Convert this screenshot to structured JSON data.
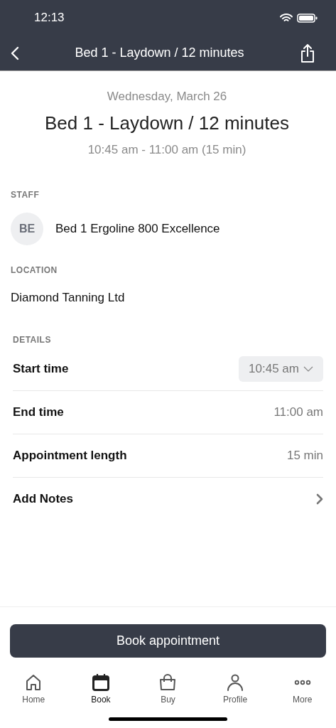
{
  "status_bar": {
    "time": "12:13"
  },
  "nav": {
    "title": "Bed 1 - Laydown / 12 minutes"
  },
  "header": {
    "date": "Wednesday, March 26",
    "title": "Bed 1 - Laydown / 12 minutes",
    "time_range": "10:45 am - 11:00 am (15 min)"
  },
  "staff": {
    "heading": "STAFF",
    "initials": "BE",
    "name": "Bed 1 Ergoline 800 Excellence"
  },
  "location": {
    "heading": "LOCATION",
    "name": "Diamond Tanning Ltd"
  },
  "details": {
    "heading": "DETAILS",
    "rows": [
      {
        "kind": "dropdown",
        "label": "Start time",
        "value": "10:45 am"
      },
      {
        "kind": "text",
        "label": "End time",
        "value": "11:00 am"
      },
      {
        "kind": "text",
        "label": "Appointment length",
        "value": "15 min"
      },
      {
        "kind": "link",
        "label": "Add Notes"
      }
    ]
  },
  "book_button": "Book appointment",
  "tabs": [
    {
      "kind": "home",
      "label": "Home",
      "selected": false
    },
    {
      "kind": "book",
      "label": "Book",
      "selected": true
    },
    {
      "kind": "buy",
      "label": "Buy",
      "selected": false
    },
    {
      "kind": "profile",
      "label": "Profile",
      "selected": false
    },
    {
      "kind": "more",
      "label": "More",
      "selected": false
    }
  ]
}
